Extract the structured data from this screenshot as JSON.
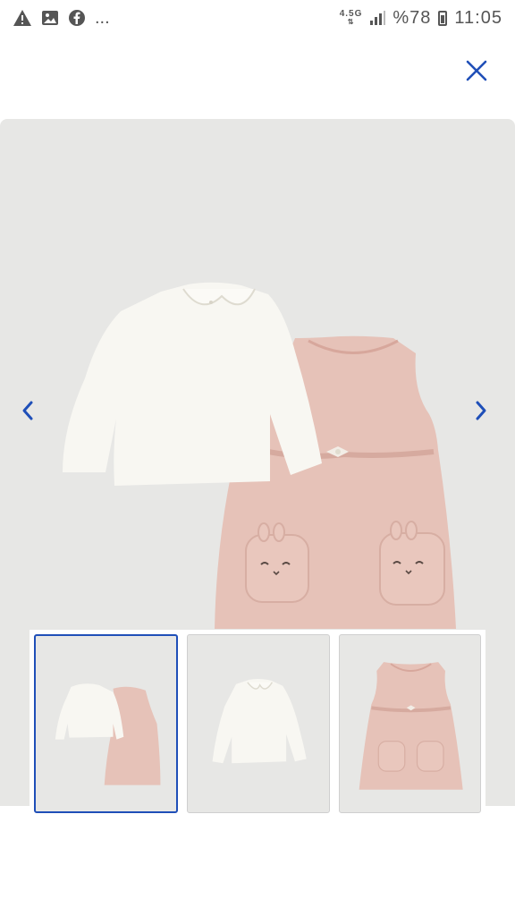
{
  "status_bar": {
    "notification_icons": [
      "alert-icon",
      "image-icon",
      "facebook-icon"
    ],
    "more": "...",
    "network_type": "4.5G",
    "battery_percent": "%78",
    "time": "11:05"
  },
  "gallery": {
    "current_index": 0,
    "thumbnails": [
      {
        "label": "Set: white shirt and pink bunny dress",
        "selected": true
      },
      {
        "label": "White collared shirt",
        "selected": false
      },
      {
        "label": "Pink bunny dress",
        "selected": false
      }
    ]
  },
  "colors": {
    "accent": "#1f4fb8",
    "background": "#e7e7e5",
    "dress": "#e6c2b8",
    "shirt": "#f8f7f2"
  }
}
